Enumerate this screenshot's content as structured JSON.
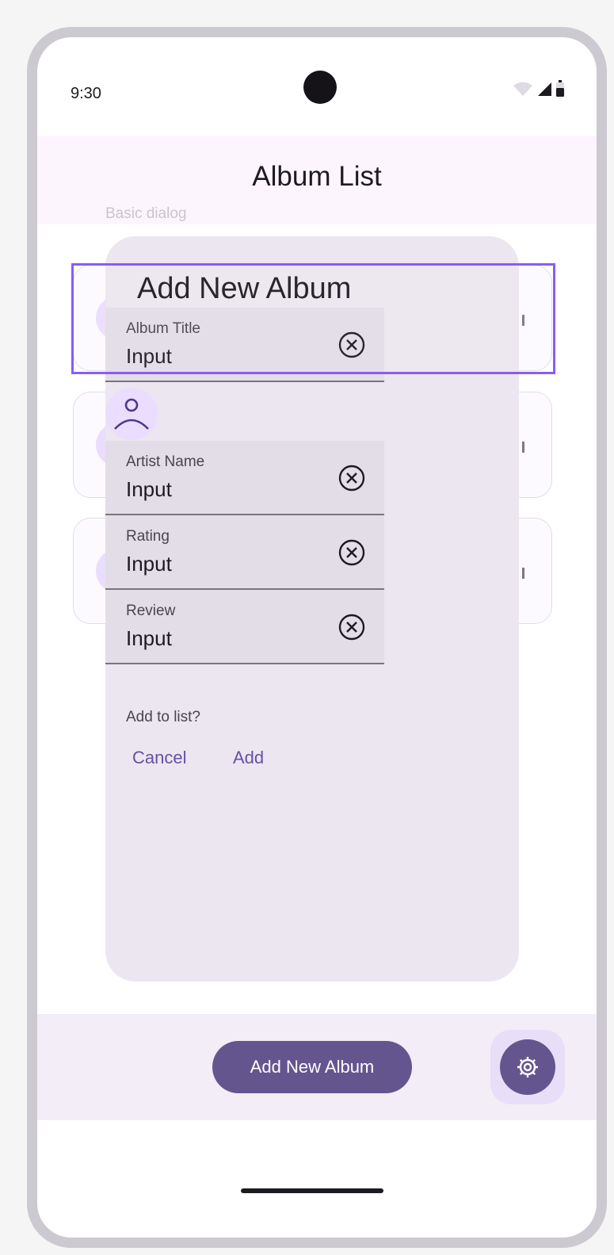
{
  "status_bar": {
    "time": "9:30",
    "icons": [
      "wifi-icon",
      "signal-icon",
      "battery-icon"
    ]
  },
  "app_bar": {
    "title": "Album List"
  },
  "annotation": {
    "label": "Basic dialog"
  },
  "dialog": {
    "title": "Add New Album",
    "fields": [
      {
        "label": "Album Title",
        "value": "Input"
      },
      {
        "label": "Artist Name",
        "value": "Input"
      },
      {
        "label": "Rating",
        "value": "Input"
      },
      {
        "label": "Review",
        "value": "Input"
      }
    ],
    "prompt": "Add to list?",
    "cancel_label": "Cancel",
    "add_label": "Add"
  },
  "bottom_bar": {
    "add_album_label": "Add New Album",
    "settings_icon": "gear-icon"
  },
  "colors": {
    "primary": "#65558f",
    "selection": "#8a5cf5",
    "dialog_bg": "#ece6f0",
    "field_bg": "#e3dde7"
  }
}
